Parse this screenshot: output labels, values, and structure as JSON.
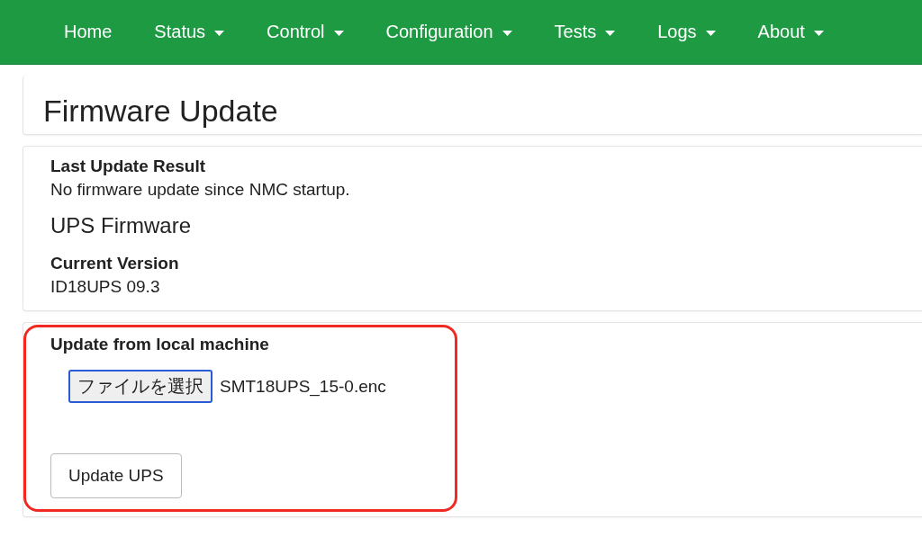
{
  "nav": {
    "items": [
      {
        "label": "Home",
        "dropdown": false
      },
      {
        "label": "Status",
        "dropdown": true
      },
      {
        "label": "Control",
        "dropdown": true
      },
      {
        "label": "Configuration",
        "dropdown": true
      },
      {
        "label": "Tests",
        "dropdown": true
      },
      {
        "label": "Logs",
        "dropdown": true
      },
      {
        "label": "About",
        "dropdown": true
      }
    ]
  },
  "page_title": "Firmware Update",
  "info_panel": {
    "last_update_heading": "Last Update Result",
    "last_update_text": "No firmware update since NMC startup.",
    "section_title": "UPS Firmware",
    "version_heading": "Current Version",
    "version_value": "ID18UPS 09.3"
  },
  "upload_panel": {
    "heading": "Update from local machine",
    "file_button": "ファイルを選択",
    "file_name": "SMT18UPS_15-0.enc",
    "submit_button": "Update UPS",
    "highlighted": true
  }
}
